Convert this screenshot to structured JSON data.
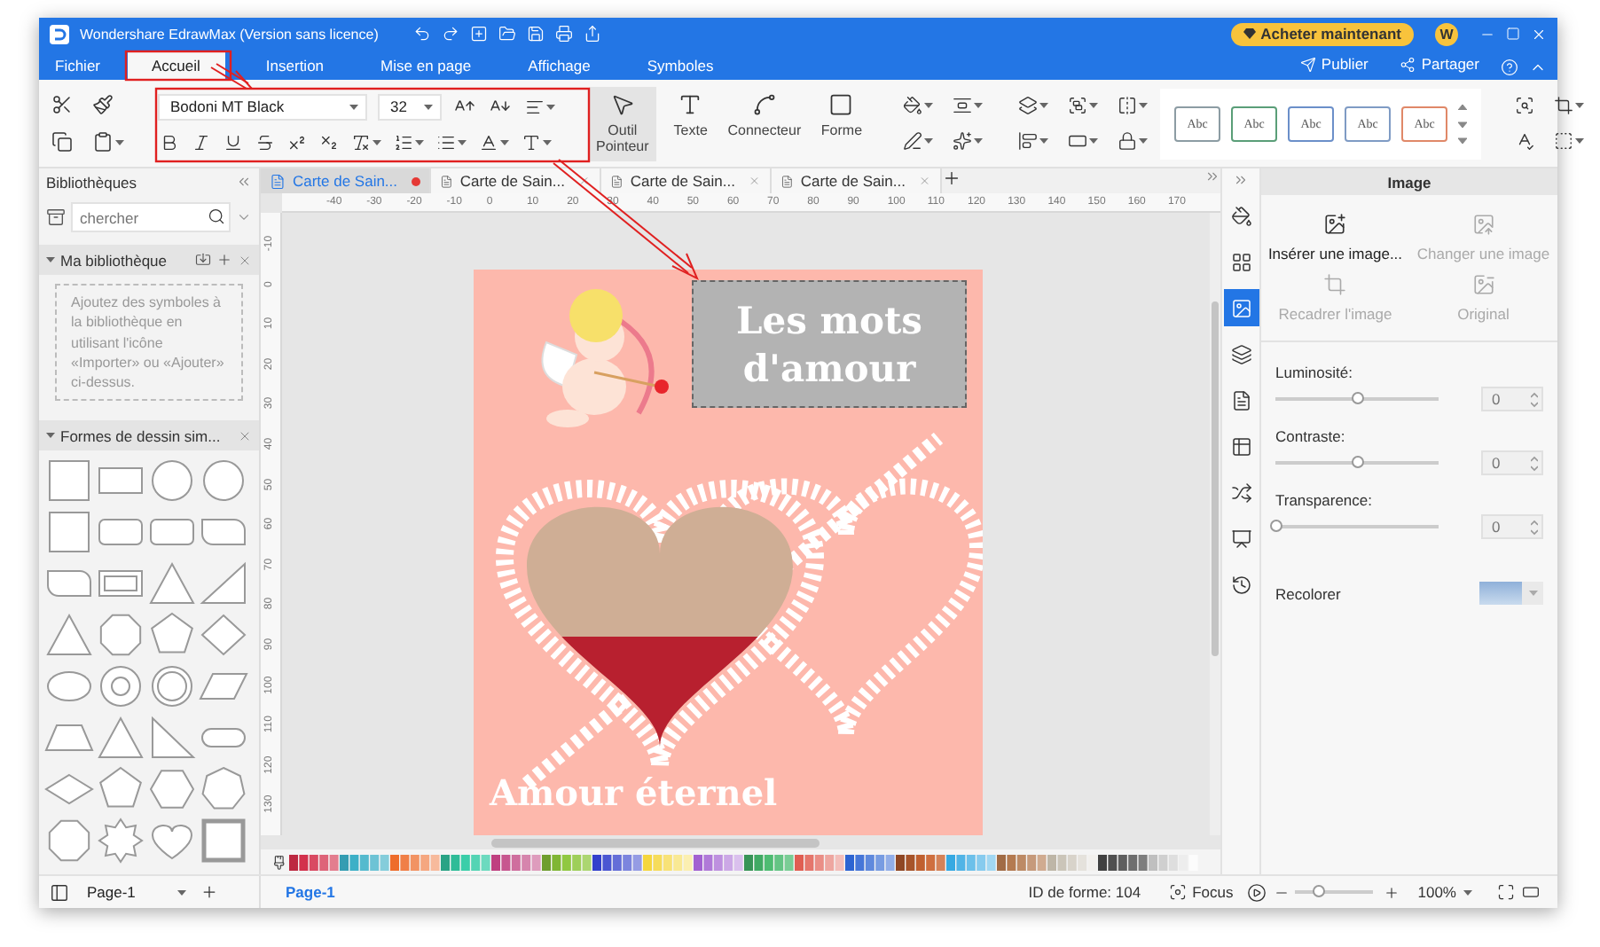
{
  "window": {
    "title": "Wondershare EdrawMax (Version sans licence)"
  },
  "header": {
    "buy_button": "Acheter maintenant",
    "avatar": "W",
    "actions": [
      "Publier",
      "Partager"
    ]
  },
  "menu_tabs": [
    {
      "label": "Fichier",
      "selected": false
    },
    {
      "label": "Accueil",
      "selected": true
    },
    {
      "label": "Insertion",
      "selected": false
    },
    {
      "label": "Mise en page",
      "selected": false
    },
    {
      "label": "Affichage",
      "selected": false
    },
    {
      "label": "Symboles",
      "selected": false
    }
  ],
  "ribbon": {
    "font": "Bodoni MT Black",
    "font_size": "32",
    "tools": [
      {
        "label": "Outil Pointeur",
        "selected": true
      },
      {
        "label": "Texte",
        "selected": false
      },
      {
        "label": "Connecteur",
        "selected": false
      },
      {
        "label": "Forme",
        "selected": false
      }
    ],
    "styles": [
      {
        "label": "Abc",
        "color": "#8c9ca3"
      },
      {
        "label": "Abc",
        "color": "#5a9e78"
      },
      {
        "label": "Abc",
        "color": "#6b8fc9"
      },
      {
        "label": "Abc",
        "color": "#7f9bc4"
      },
      {
        "label": "Abc",
        "color": "#e08868"
      }
    ]
  },
  "library": {
    "title": "Bibliothèques",
    "search_placeholder": "chercher",
    "sections": [
      {
        "title": "Ma bibliothèque",
        "expanded": true
      },
      {
        "title": "Formes de dessin sim...",
        "expanded": true
      }
    ],
    "hint": "Ajoutez des symboles à la bibliothèque en utilisant l'icône «Importer» ou «Ajouter» ci-dessus."
  },
  "document_tabs": [
    {
      "label": "Carte de Sain...",
      "selected": true,
      "modified": true
    },
    {
      "label": "Carte de Sain...",
      "selected": false,
      "modified": false
    },
    {
      "label": "Carte de Sain...",
      "selected": false,
      "modified": false
    },
    {
      "label": "Carte de Sain...",
      "selected": false,
      "modified": false
    }
  ],
  "rulers": {
    "horizontal": [
      "-40",
      "-30",
      "-20",
      "-10",
      "0",
      "10",
      "20",
      "30",
      "40",
      "50",
      "60",
      "70",
      "80",
      "90",
      "100",
      "110",
      "120",
      "130",
      "140",
      "150",
      "160",
      "170"
    ],
    "vertical": [
      "-10",
      "0",
      "10",
      "20",
      "30",
      "40",
      "50",
      "60",
      "70",
      "80",
      "90",
      "100",
      "110",
      "120",
      "130"
    ]
  },
  "canvas": {
    "heading": "Les mots d'amour",
    "title": "Amour éternel"
  },
  "side_tabs": [
    {
      "selected": false
    },
    {
      "selected": false
    },
    {
      "selected": true
    },
    {
      "selected": false
    },
    {
      "selected": false
    },
    {
      "selected": false
    },
    {
      "selected": false
    },
    {
      "selected": false
    },
    {
      "selected": false
    }
  ],
  "properties": {
    "title": "Image",
    "actions": [
      {
        "label": "Insérer une image...",
        "disabled": false
      },
      {
        "label": "Changer une image",
        "disabled": true
      },
      {
        "label": "Recadrer l'image",
        "disabled": true
      },
      {
        "label": "Original",
        "disabled": true
      }
    ],
    "sliders": [
      {
        "label": "Luminosité:",
        "level": 0.5,
        "value": "0"
      },
      {
        "label": "Contraste:",
        "level": 0.5,
        "value": "0"
      },
      {
        "label": "Transparence:",
        "level": 0,
        "value": "0"
      }
    ],
    "recolor_label": "Recolorer"
  },
  "status_bar": {
    "page_select": "Page-1",
    "page_tab": "Page-1",
    "shape_id": "ID de forme: 104",
    "focus": "Focus",
    "zoom": {
      "level": 0.3,
      "value": "100%"
    }
  }
}
